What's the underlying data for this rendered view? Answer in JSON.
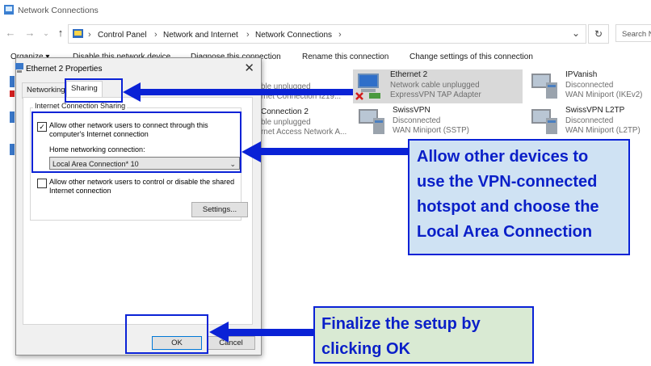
{
  "window": {
    "title": "Network Connections"
  },
  "address_bar": {
    "crumbs": [
      "Control Panel",
      "Network and Internet",
      "Network Connections"
    ],
    "search_placeholder": "Search N"
  },
  "command_bar": {
    "organize": "Organize ▾",
    "disable": "Disable this network device",
    "diagnose": "Diagnose this connection",
    "rename": "Rename this connection",
    "change": "Change settings of this connection"
  },
  "network_items": {
    "partial_1_status": "ble unplugged",
    "partial_1_device": "rnet Connection I219...",
    "partial_2_name": "Connection 2",
    "partial_2_status": "ble unplugged",
    "partial_2_device": "rnet Access Network A...",
    "ethernet2": {
      "name": "Ethernet 2",
      "status": "Network cable unplugged",
      "device": "ExpressVPN TAP Adapter"
    },
    "ipvanish": {
      "name": "IPVanish",
      "status": "Disconnected",
      "device": "WAN Miniport (IKEv2)"
    },
    "swissvpn": {
      "name": "SwissVPN",
      "status": "Disconnected",
      "device": "WAN Miniport (SSTP)"
    },
    "swissvpn_l2tp": {
      "name": "SwissVPN L2TP",
      "status": "Disconnected",
      "device": "WAN Miniport (L2TP)"
    }
  },
  "dialog": {
    "title": "Ethernet 2 Properties",
    "close": "✕",
    "tabs": [
      "Networking",
      "Sharing"
    ],
    "group_title": "Internet Connection Sharing",
    "allow_connect_label": "Allow other network users to connect through this computer's Internet connection",
    "allow_connect_checked": true,
    "home_networking_label": "Home networking connection:",
    "home_networking_value": "Local Area Connection* 10",
    "allow_control_label": "Allow other network users to control or disable the shared Internet connection",
    "allow_control_checked": false,
    "settings_button": "Settings...",
    "ok_button": "OK",
    "cancel_button": "Cancel"
  },
  "annotations": {
    "callout_1": [
      "Allow other devices to",
      "use the  VPN-connected",
      "hotspot and choose the",
      "Local Area Connection"
    ],
    "callout_2": [
      "Finalize  the setup by",
      "clicking OK"
    ],
    "accent_color": "#0a22d6",
    "callout_1_bg": "#cfe2f3",
    "callout_2_bg": "#d9ead3"
  }
}
